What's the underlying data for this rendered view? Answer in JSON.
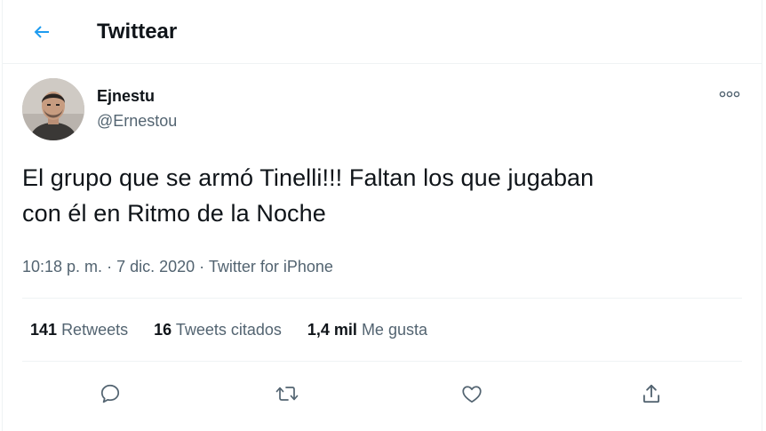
{
  "header": {
    "title": "Twittear",
    "back_icon": "arrow-left-icon"
  },
  "author": {
    "name": "Ejnestu",
    "handle": "@Ernestou"
  },
  "tweet": {
    "text_line1": "El grupo que se armó Tinelli!!! Faltan los que jugaban",
    "text_line2": "con él en Ritmo de la Noche"
  },
  "meta": {
    "time": "10:18 p. m.",
    "sep1": " · ",
    "date": "7 dic. 2020",
    "sep2": " · ",
    "source": "Twitter for iPhone"
  },
  "stats": {
    "retweets": {
      "count": "141",
      "label": "Retweets"
    },
    "quotes": {
      "count": "16",
      "label": "Tweets citados"
    },
    "likes": {
      "count": "1,4 mil",
      "label": "Me gusta"
    }
  },
  "actions": [
    "reply-icon",
    "retweet-icon",
    "like-icon",
    "share-icon"
  ],
  "colors": {
    "accent": "#1d9bf0",
    "text": "#0f1419",
    "secondary": "#536471",
    "border": "#eff3f4"
  }
}
